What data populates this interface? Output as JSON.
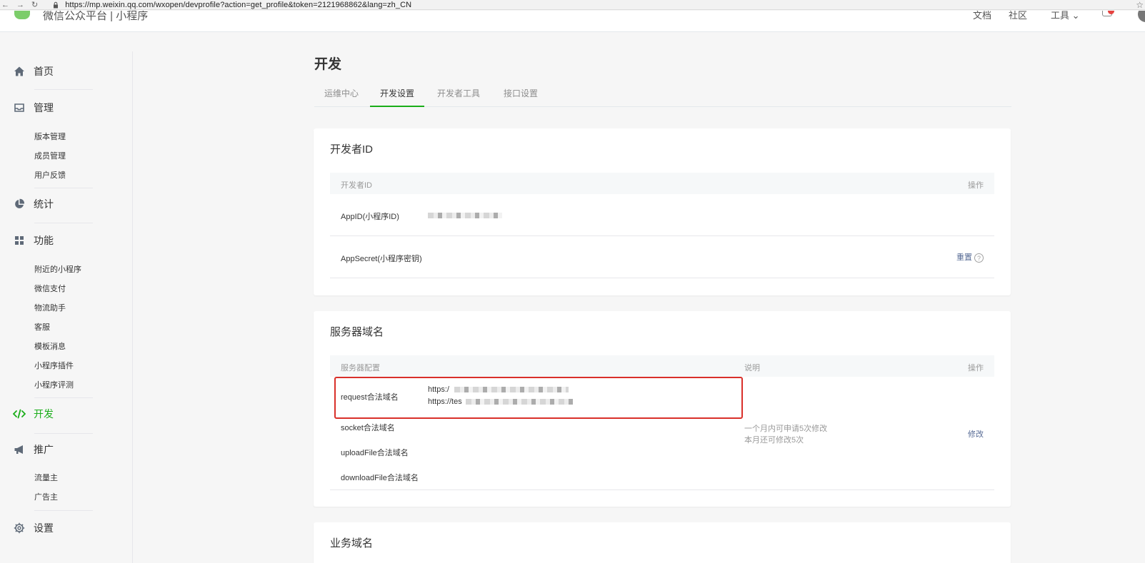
{
  "browser": {
    "url": "https://mp.weixin.qq.com/wxopen/devprofile?action=get_profile&token=2121968862&lang=zh_CN",
    "back": "←",
    "forward": "→",
    "reload": "↻",
    "star": "☆"
  },
  "header": {
    "site_title": "微信公众平台 | 小程序",
    "nav": [
      "文档",
      "社区",
      "工具 ⌄"
    ]
  },
  "sidebar": {
    "groups": [
      {
        "label": "首页",
        "icon": "home-icon",
        "items": []
      },
      {
        "label": "管理",
        "icon": "inbox-icon",
        "items": [
          "版本管理",
          "成员管理",
          "用户反馈"
        ]
      },
      {
        "label": "统计",
        "icon": "pie-chart-icon",
        "items": []
      },
      {
        "label": "功能",
        "icon": "grid-icon",
        "items": [
          "附近的小程序",
          "微信支付",
          "物流助手",
          "客服",
          "模板消息",
          "小程序插件",
          "小程序评测"
        ]
      },
      {
        "label": "开发",
        "icon": "code-icon",
        "items": [],
        "active": true
      },
      {
        "label": "推广",
        "icon": "megaphone-icon",
        "items": [
          "流量主",
          "广告主"
        ]
      },
      {
        "label": "设置",
        "icon": "gear-icon",
        "items": []
      }
    ]
  },
  "main": {
    "title": "开发",
    "tabs": [
      "运维中心",
      "开发设置",
      "开发者工具",
      "接口设置"
    ],
    "active_tab": "开发设置",
    "developer_id": {
      "title": "开发者ID",
      "col_id": "开发者ID",
      "col_action": "操作",
      "rows": [
        {
          "label": "AppID(小程序ID)",
          "value_blurred": true
        },
        {
          "label": "AppSecret(小程序密钥)",
          "action": "重置"
        }
      ]
    },
    "server_domain": {
      "title": "服务器域名",
      "col_config": "服务器配置",
      "col_desc": "说明",
      "col_action": "操作",
      "rows": [
        {
          "label": "request合法域名",
          "values": [
            "https:/",
            "https://tes"
          ]
        },
        {
          "label": "socket合法域名"
        },
        {
          "label": "uploadFile合法域名"
        },
        {
          "label": "downloadFile合法域名"
        }
      ],
      "desc_lines": [
        "一个月内可申请5次修改",
        "本月还可修改5次"
      ],
      "action": "修改"
    },
    "business_domain": {
      "title": "业务域名"
    }
  },
  "colors": {
    "accent": "#1aad19",
    "link": "#576b95",
    "highlight": "#d9302a"
  }
}
